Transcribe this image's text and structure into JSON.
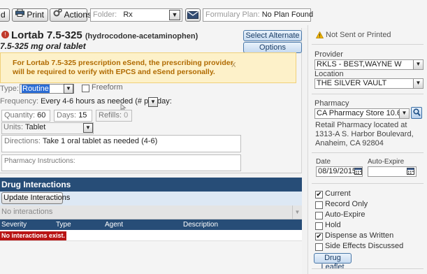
{
  "toolbar": {
    "first_button_partial": "d",
    "print_label": "Print",
    "actions_label": "Actions",
    "folder_label": "Folder:",
    "folder_value": "Rx",
    "formulary_label": "Formulary Plan:",
    "formulary_value": "No Plan Found"
  },
  "drug": {
    "name": "Lortab 7.5-325",
    "generic": "(hydrocodone-acetaminophen)",
    "sig_header": "7.5-325 mg oral tablet",
    "select_alternate_label": "Select Alternate",
    "options_label": "Options"
  },
  "alert": {
    "text": "For Lortab 7.5-325 prescription eSend, the prescribing provider will be required to verify with EPCS and eSend personally.",
    "close": "x"
  },
  "form": {
    "type_label": "Type:",
    "type_value": "Routine",
    "freeform_label": "Freeform",
    "frequency_label": "Frequency:",
    "frequency_value": "Every 4-6 hours as needed (# per day:",
    "quantity_label": "Quantity:",
    "quantity_value": "60",
    "days_label": "Days:",
    "days_value": "15",
    "refills_label": "Refills:",
    "refills_value": "0",
    "units_label": "Units:",
    "units_value": "Tablet",
    "directions_label": "Directions:",
    "directions_value": "Take 1 oral tablet as needed (4-6)",
    "pharmacy_instructions_label": "Pharmacy Instructions:"
  },
  "interactions": {
    "header": "Drug Interactions",
    "update_label": "Update Interactions",
    "filter_value": "No interactions",
    "columns": [
      "Severity",
      "Type",
      "Agent",
      "Description"
    ],
    "empty_message": "No interactions exist."
  },
  "right": {
    "status": "Not Sent or Printed",
    "provider_label": "Provider",
    "provider_value": "RKLS - BEST,WAYNE W",
    "location_label": "Location",
    "location_value": "THE SILVER VAULT",
    "pharmacy_label": "Pharmacy",
    "pharmacy_value": "CA Pharmacy Store 10.6",
    "pharmacy_desc_1": "Retail Pharmacy located at",
    "pharmacy_desc_2": "1313-A S. Harbor Boulevard,",
    "pharmacy_desc_3": "Anaheim, CA 92804",
    "date_label": "Date",
    "date_value": "08/19/2015",
    "auto_expire_label": "Auto-Expire",
    "auto_expire_value": "",
    "checkboxes": [
      {
        "label": "Current",
        "checked": true
      },
      {
        "label": "Record Only",
        "checked": false
      },
      {
        "label": "Auto-Expire",
        "checked": false
      },
      {
        "label": "Hold",
        "checked": false
      },
      {
        "label": "Dispense as Written",
        "checked": true
      },
      {
        "label": "Side Effects Discussed",
        "checked": false
      }
    ],
    "check_mark": "✔",
    "leaflet_label": "Drug Leaflet"
  },
  "colors": {
    "header_blue": "#274d77",
    "alert_bg": "#fdf1c9",
    "alert_text": "#b06a00",
    "error_red": "#b81414"
  }
}
